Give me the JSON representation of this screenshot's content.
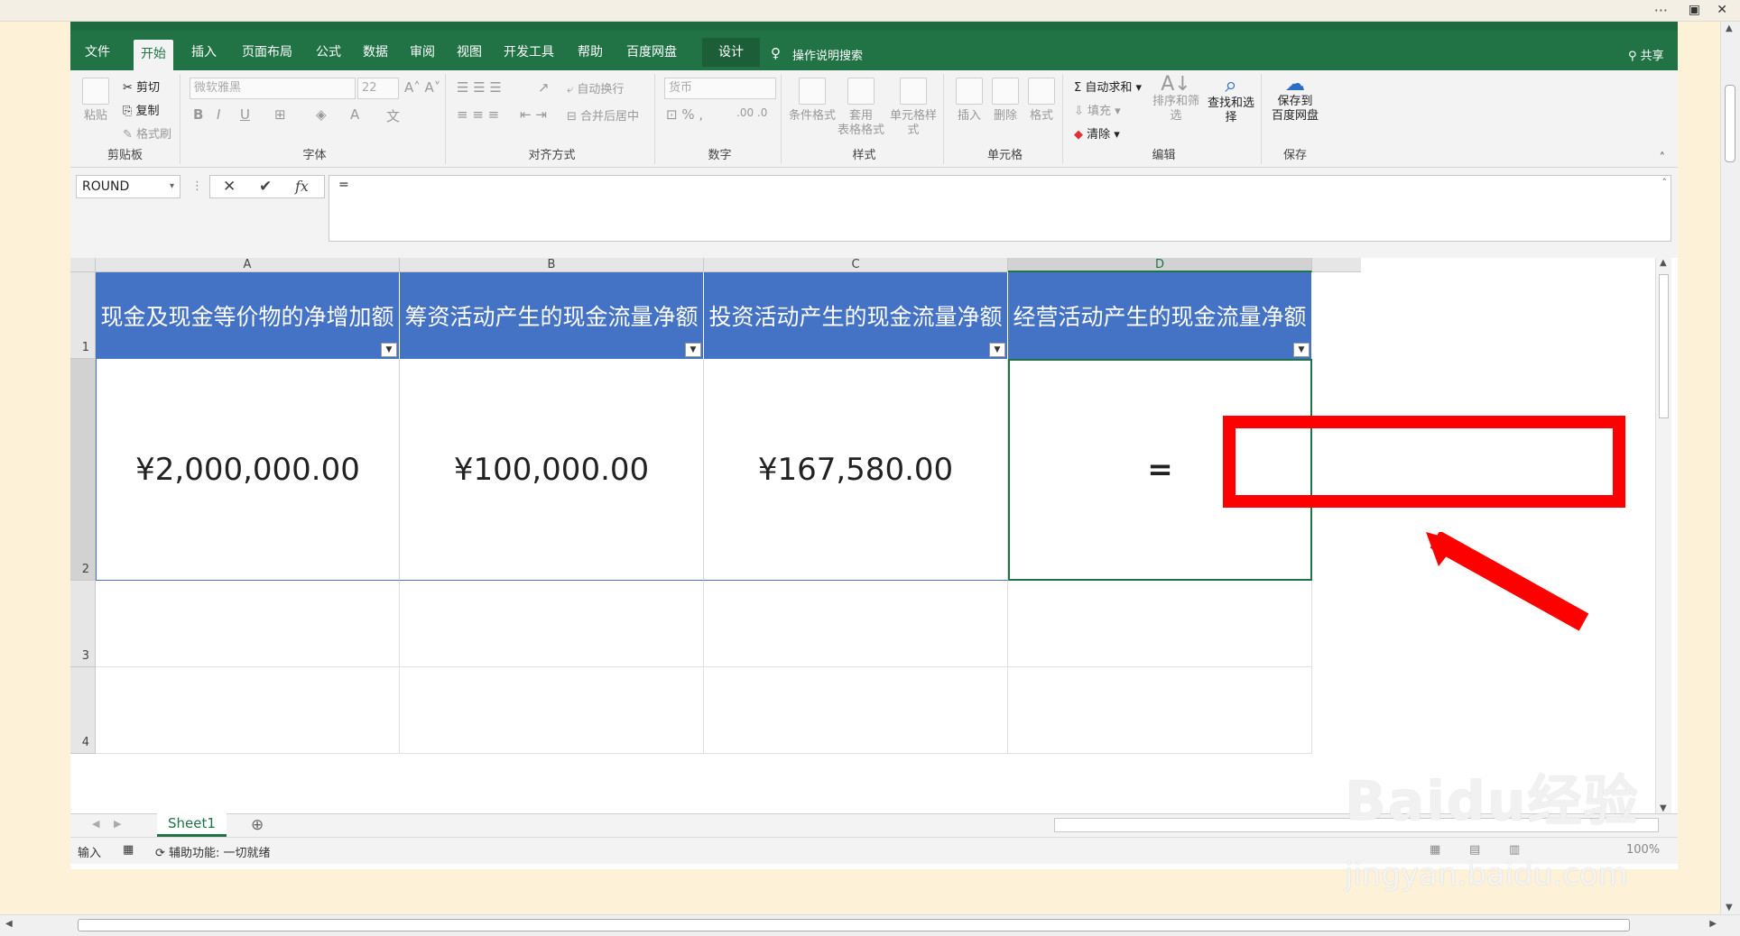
{
  "tabs": [
    "文件",
    "开始",
    "插入",
    "页面布局",
    "公式",
    "数据",
    "审阅",
    "视图",
    "开发工具",
    "帮助",
    "百度网盘",
    "设计"
  ],
  "active_tab": "开始",
  "tell_me": "操作说明搜索",
  "share": "共享",
  "ribbon": {
    "clipboard": {
      "paste": "粘贴",
      "cut": "剪切",
      "copy": "复制",
      "format_painter": "格式刷",
      "label": "剪贴板"
    },
    "font": {
      "name": "微软雅黑",
      "size": "22",
      "label": "字体"
    },
    "alignment": {
      "wrap": "自动换行",
      "merge": "合并后居中",
      "label": "对齐方式"
    },
    "number": {
      "format": "货币",
      "label": "数字"
    },
    "styles": {
      "conditional": "条件格式",
      "table_line1": "套用",
      "table_line2": "表格格式",
      "cell_styles": "单元格样式",
      "label": "样式"
    },
    "cells": {
      "insert": "插入",
      "delete": "删除",
      "format": "格式",
      "label": "单元格"
    },
    "editing": {
      "autosum": "自动求和",
      "fill": "填充",
      "clear": "清除",
      "sort": "排序和筛选",
      "find": "查找和选择",
      "label": "编辑"
    },
    "save": {
      "line1": "保存到",
      "line2": "百度网盘",
      "label": "保存"
    }
  },
  "namebox": "ROUND",
  "formula": "=",
  "columns": [
    "A",
    "B",
    "C",
    "D"
  ],
  "rows": [
    "1",
    "2",
    "3",
    "4"
  ],
  "header_cells": [
    "现金及现金等价物的净增加额",
    "筹资活动产生的现金流量净额",
    "投资活动产生的现金流量净额",
    "经营活动产生的现金流量净额"
  ],
  "data_cells": [
    "¥2,000,000.00",
    "¥100,000.00",
    "¥167,580.00",
    "="
  ],
  "sheet_tab": "Sheet1",
  "status": {
    "mode": "输入",
    "accessibility": "辅助功能: 一切就绪",
    "zoom": "100%"
  },
  "colors": {
    "excel_green": "#217346",
    "header_fill": "#4472c4",
    "highlight": "#ff0000"
  },
  "watermark": {
    "logo": "Baidu经验",
    "url": "jingyan.baidu.com"
  }
}
